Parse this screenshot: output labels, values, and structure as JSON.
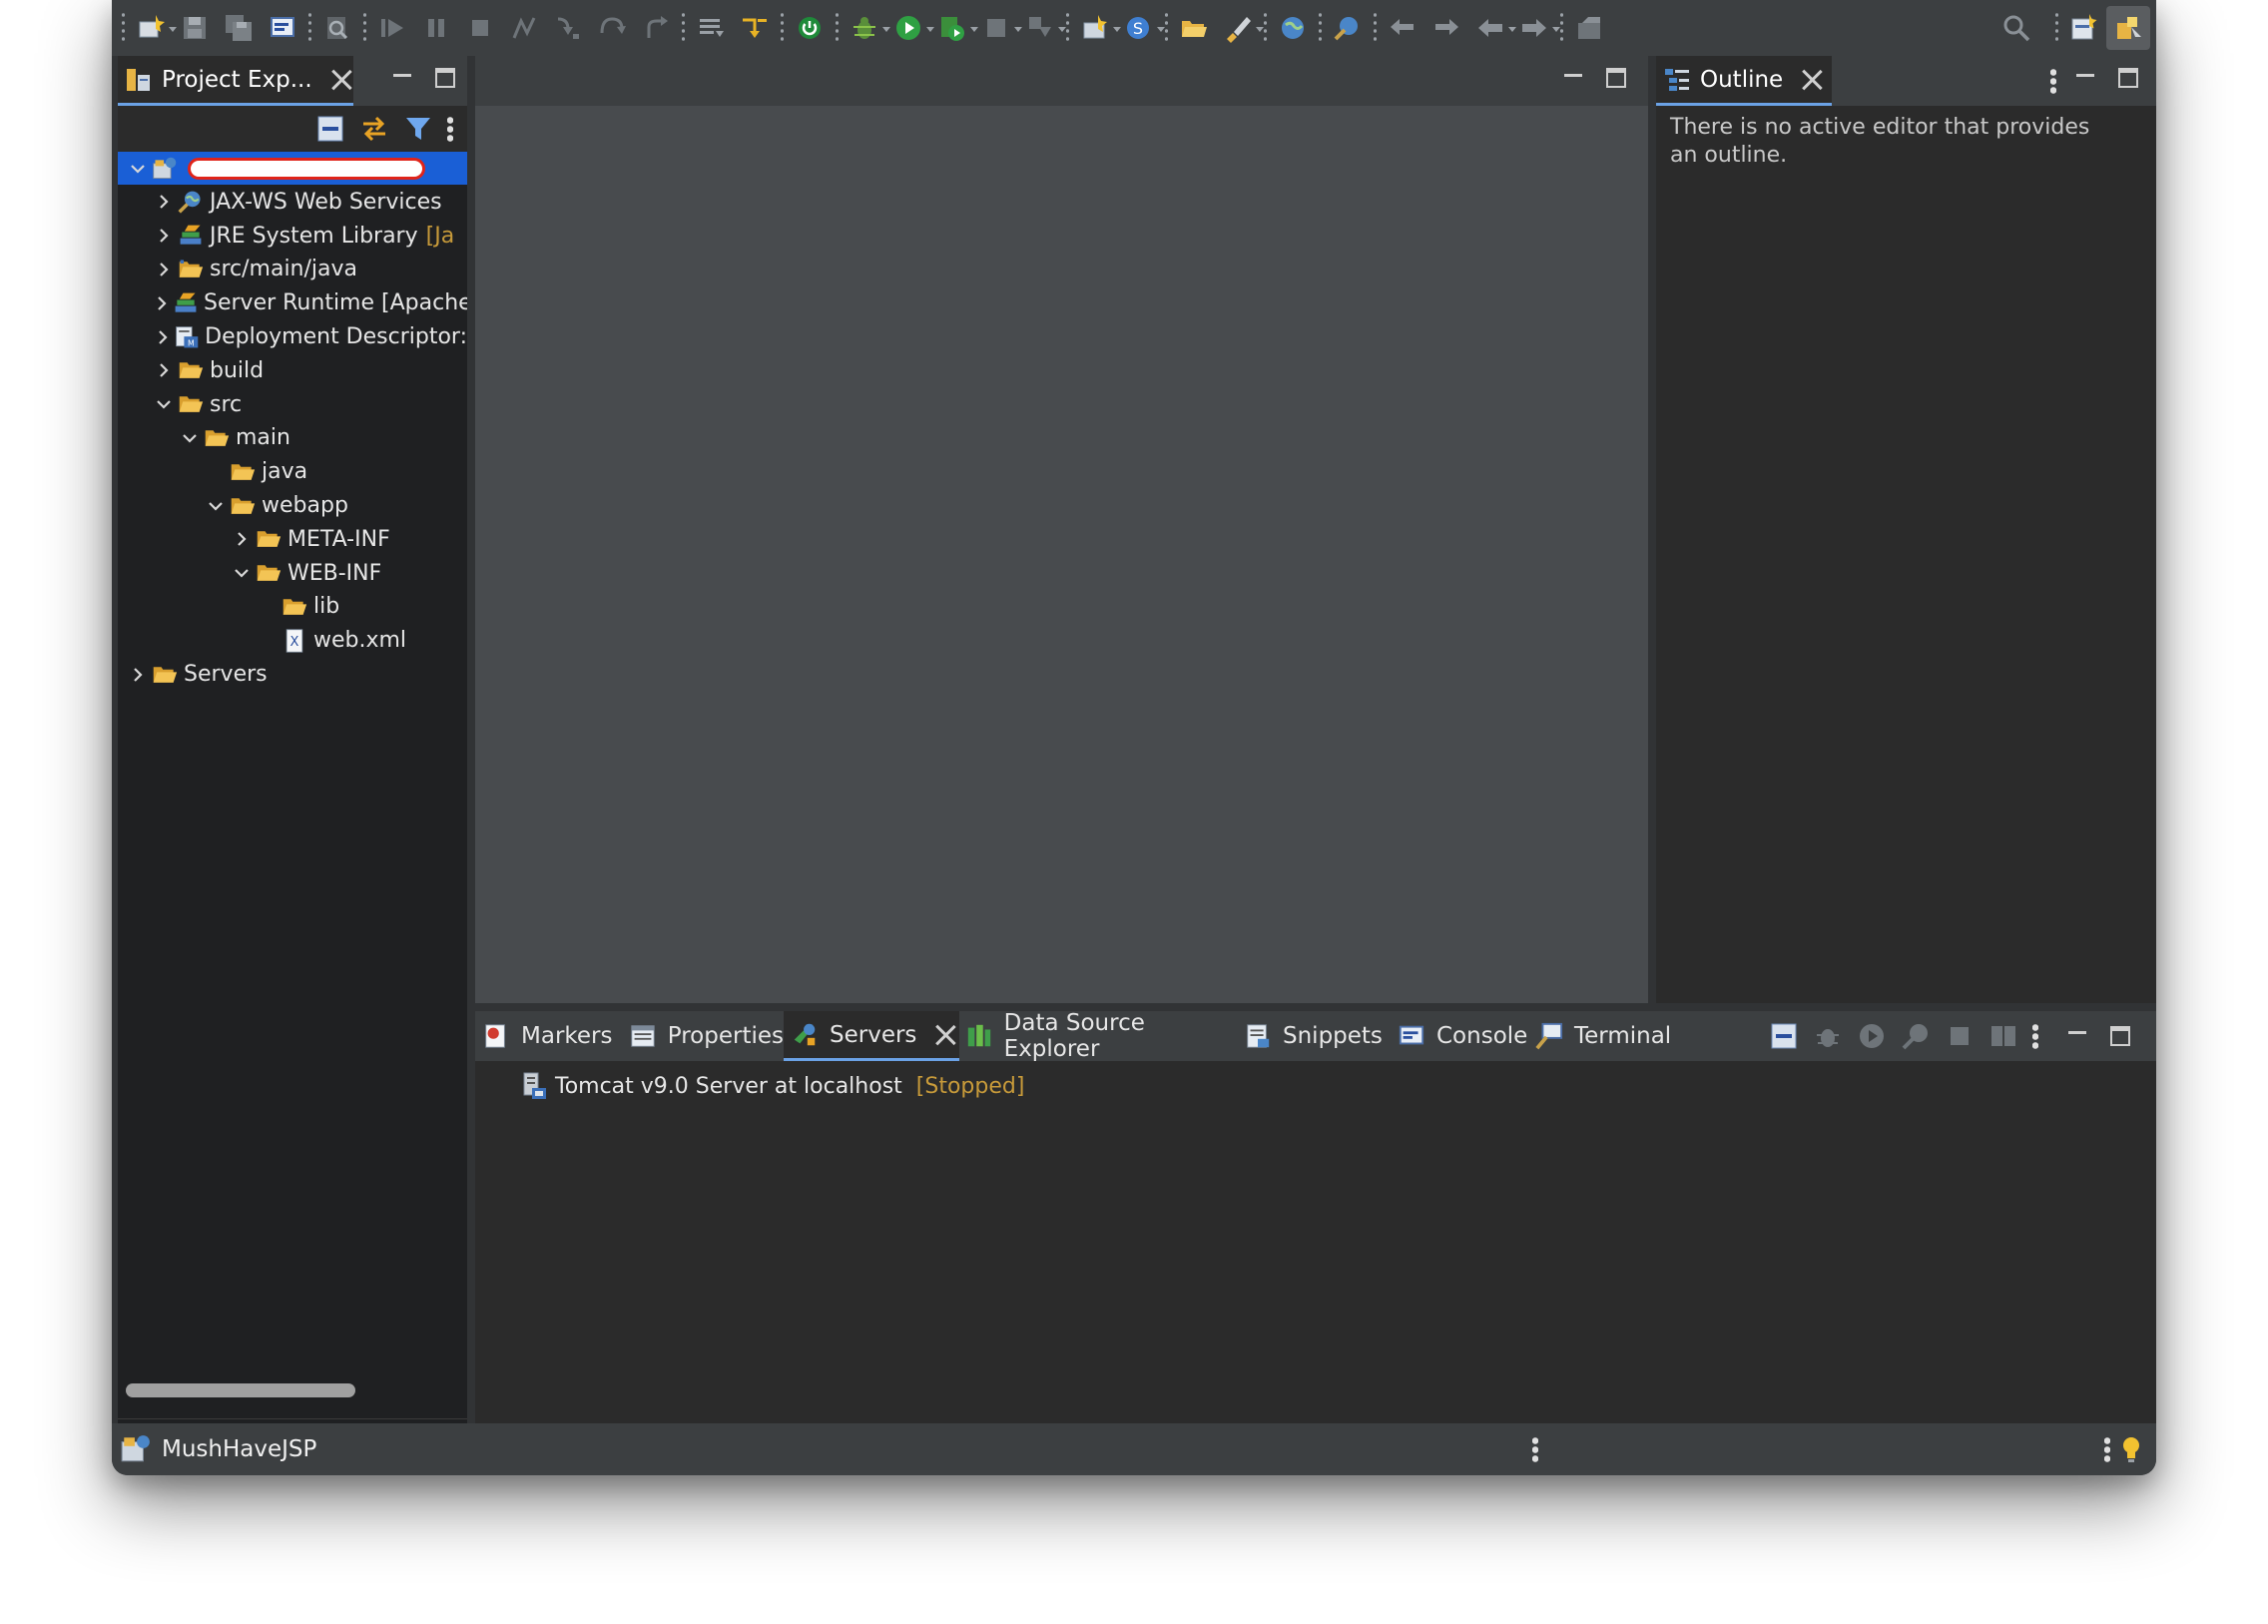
{
  "toolbar": {
    "buttons": [
      "new-icon",
      "save-icon",
      "save-all-icon",
      "console-icon",
      "search-file-icon",
      "resume-icon",
      "suspend-icon",
      "terminate-icon",
      "disconnect-icon",
      "step-into-icon",
      "step-over-icon",
      "step-return-icon",
      "list-icon",
      "debug-arrow-icon",
      "power-icon",
      "debug-icon",
      "run-icon",
      "run-server-icon",
      "stop-server-icon",
      "external-tools-icon",
      "new-package-icon",
      "new-class-icon",
      "open-folder-icon",
      "brush-icon",
      "web-icon",
      "web-service-icon",
      "back-icon",
      "forward-icon",
      "nav-back-icon",
      "nav-forward-icon",
      "pin-icon",
      "search-icon",
      "perspective-icon",
      "java-ee-perspective-icon"
    ]
  },
  "project_explorer": {
    "tab_label": "Project Exp...",
    "tree": [
      {
        "label": "",
        "redacted": true,
        "icon": "project-icon",
        "expanded": true,
        "level": 0,
        "selected": true
      },
      {
        "label": "JAX-WS Web Services",
        "icon": "webservices-icon",
        "expanded": false,
        "level": 1
      },
      {
        "label": "JRE System Library",
        "decoration": "[Ja",
        "icon": "library-icon",
        "expanded": false,
        "level": 1
      },
      {
        "label": "src/main/java",
        "icon": "source-folder-icon",
        "expanded": false,
        "level": 1
      },
      {
        "label": "Server Runtime [Apache",
        "icon": "library-icon",
        "expanded": false,
        "level": 1
      },
      {
        "label": "Deployment Descriptor:",
        "icon": "descriptor-icon",
        "expanded": false,
        "level": 1
      },
      {
        "label": "build",
        "icon": "folder-icon",
        "expanded": false,
        "level": 1
      },
      {
        "label": "src",
        "icon": "folder-icon",
        "expanded": true,
        "level": 1
      },
      {
        "label": "main",
        "icon": "folder-icon",
        "expanded": true,
        "level": 2
      },
      {
        "label": "java",
        "icon": "folder-icon",
        "expanded": null,
        "level": 3
      },
      {
        "label": "webapp",
        "icon": "folder-icon",
        "expanded": true,
        "level": 3
      },
      {
        "label": "META-INF",
        "icon": "folder-icon",
        "expanded": false,
        "level": 4
      },
      {
        "label": "WEB-INF",
        "icon": "folder-icon",
        "expanded": true,
        "level": 4
      },
      {
        "label": "lib",
        "icon": "folder-icon",
        "expanded": null,
        "level": 5
      },
      {
        "label": "web.xml",
        "icon": "xml-file-icon",
        "expanded": null,
        "level": 5
      },
      {
        "label": "Servers",
        "icon": "folder-icon",
        "expanded": false,
        "level": 0
      }
    ]
  },
  "outline": {
    "tab_label": "Outline",
    "message": "There is no active editor that provides an outline."
  },
  "bottom_panel": {
    "tabs": [
      {
        "label": "Markers",
        "icon": "markers-icon"
      },
      {
        "label": "Properties",
        "icon": "properties-icon"
      },
      {
        "label": "Servers",
        "icon": "servers-icon",
        "active": true
      },
      {
        "label": "Data Source Explorer",
        "icon": "datasource-icon"
      },
      {
        "label": "Snippets",
        "icon": "snippets-icon"
      },
      {
        "label": "Console",
        "icon": "console-icon"
      },
      {
        "label": "Terminal",
        "icon": "terminal-icon"
      }
    ],
    "server": {
      "name": "Tomcat v9.0 Server at localhost",
      "status": "[Stopped]"
    }
  },
  "status_bar": {
    "label": "MushHaveJSP"
  },
  "colors": {
    "selection": "#1a5fd6",
    "decoration": "#c79a3a",
    "folder": "#e7b444",
    "accent_tab": "#6ba2e6"
  }
}
